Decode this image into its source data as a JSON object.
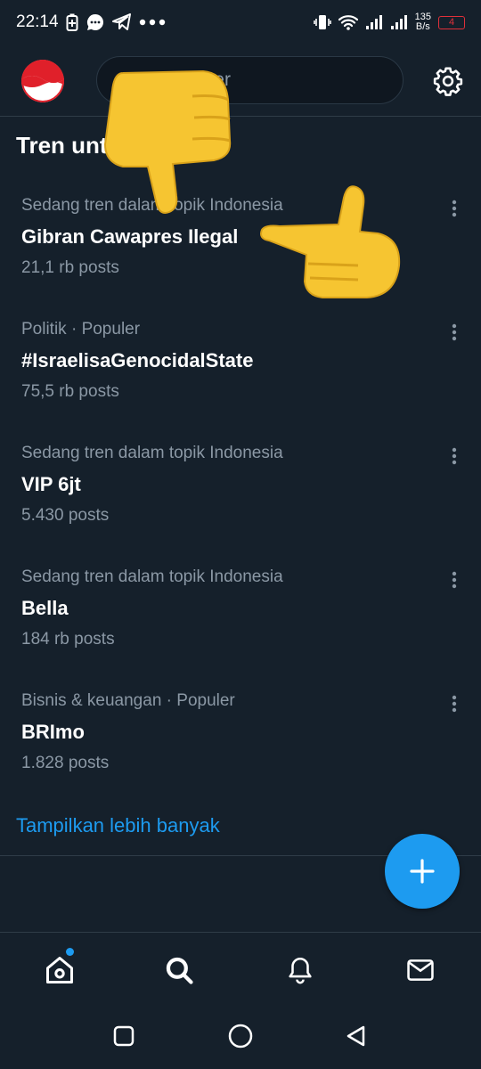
{
  "status_bar": {
    "time": "22:14",
    "net_speed_value": "135",
    "net_speed_unit": "B/s",
    "battery": "4",
    "left_icons": [
      "battery-saver-icon",
      "message-icon",
      "telegram-icon",
      "more-dots-icon"
    ],
    "right_icons": [
      "vibrate-icon",
      "wifi-icon",
      "signal-icon",
      "signal-icon"
    ]
  },
  "header": {
    "search_placeholder": "Cari di Twitter",
    "avatar_icon": "profile-avatar",
    "settings_icon": "gear-icon"
  },
  "page": {
    "title": "Tren untuk Anda"
  },
  "trends": [
    {
      "context": "Sedang tren dalam topik Indonesia",
      "name": "Gibran Cawapres Ilegal",
      "count": "21,1 rb posts"
    },
    {
      "context": "Politik · Populer",
      "name": "#IsraelisaGenocidalState",
      "count": "75,5 rb posts"
    },
    {
      "context": "Sedang tren dalam topik Indonesia",
      "name": "VIP 6jt",
      "count": "5.430 posts"
    },
    {
      "context": "Sedang tren dalam topik Indonesia",
      "name": "Bella",
      "count": "184 rb posts"
    },
    {
      "context": "Bisnis & keuangan · Populer",
      "name": "BRImo",
      "count": "1.828 posts"
    }
  ],
  "show_more": "Tampilkan lebih banyak",
  "fab": {
    "icon": "plus-icon"
  },
  "bottom_nav": [
    "home-icon",
    "search-icon",
    "bell-icon",
    "mail-icon"
  ],
  "system_nav": [
    "recents-icon",
    "home-circle-icon",
    "back-icon"
  ],
  "colors": {
    "background": "#15202b",
    "accent": "#1d9bf0",
    "secondary_text": "#8b98a5",
    "battery_low": "#e0303a"
  },
  "stickers": [
    "thumbs-down-emoji",
    "pointing-left-emoji"
  ]
}
